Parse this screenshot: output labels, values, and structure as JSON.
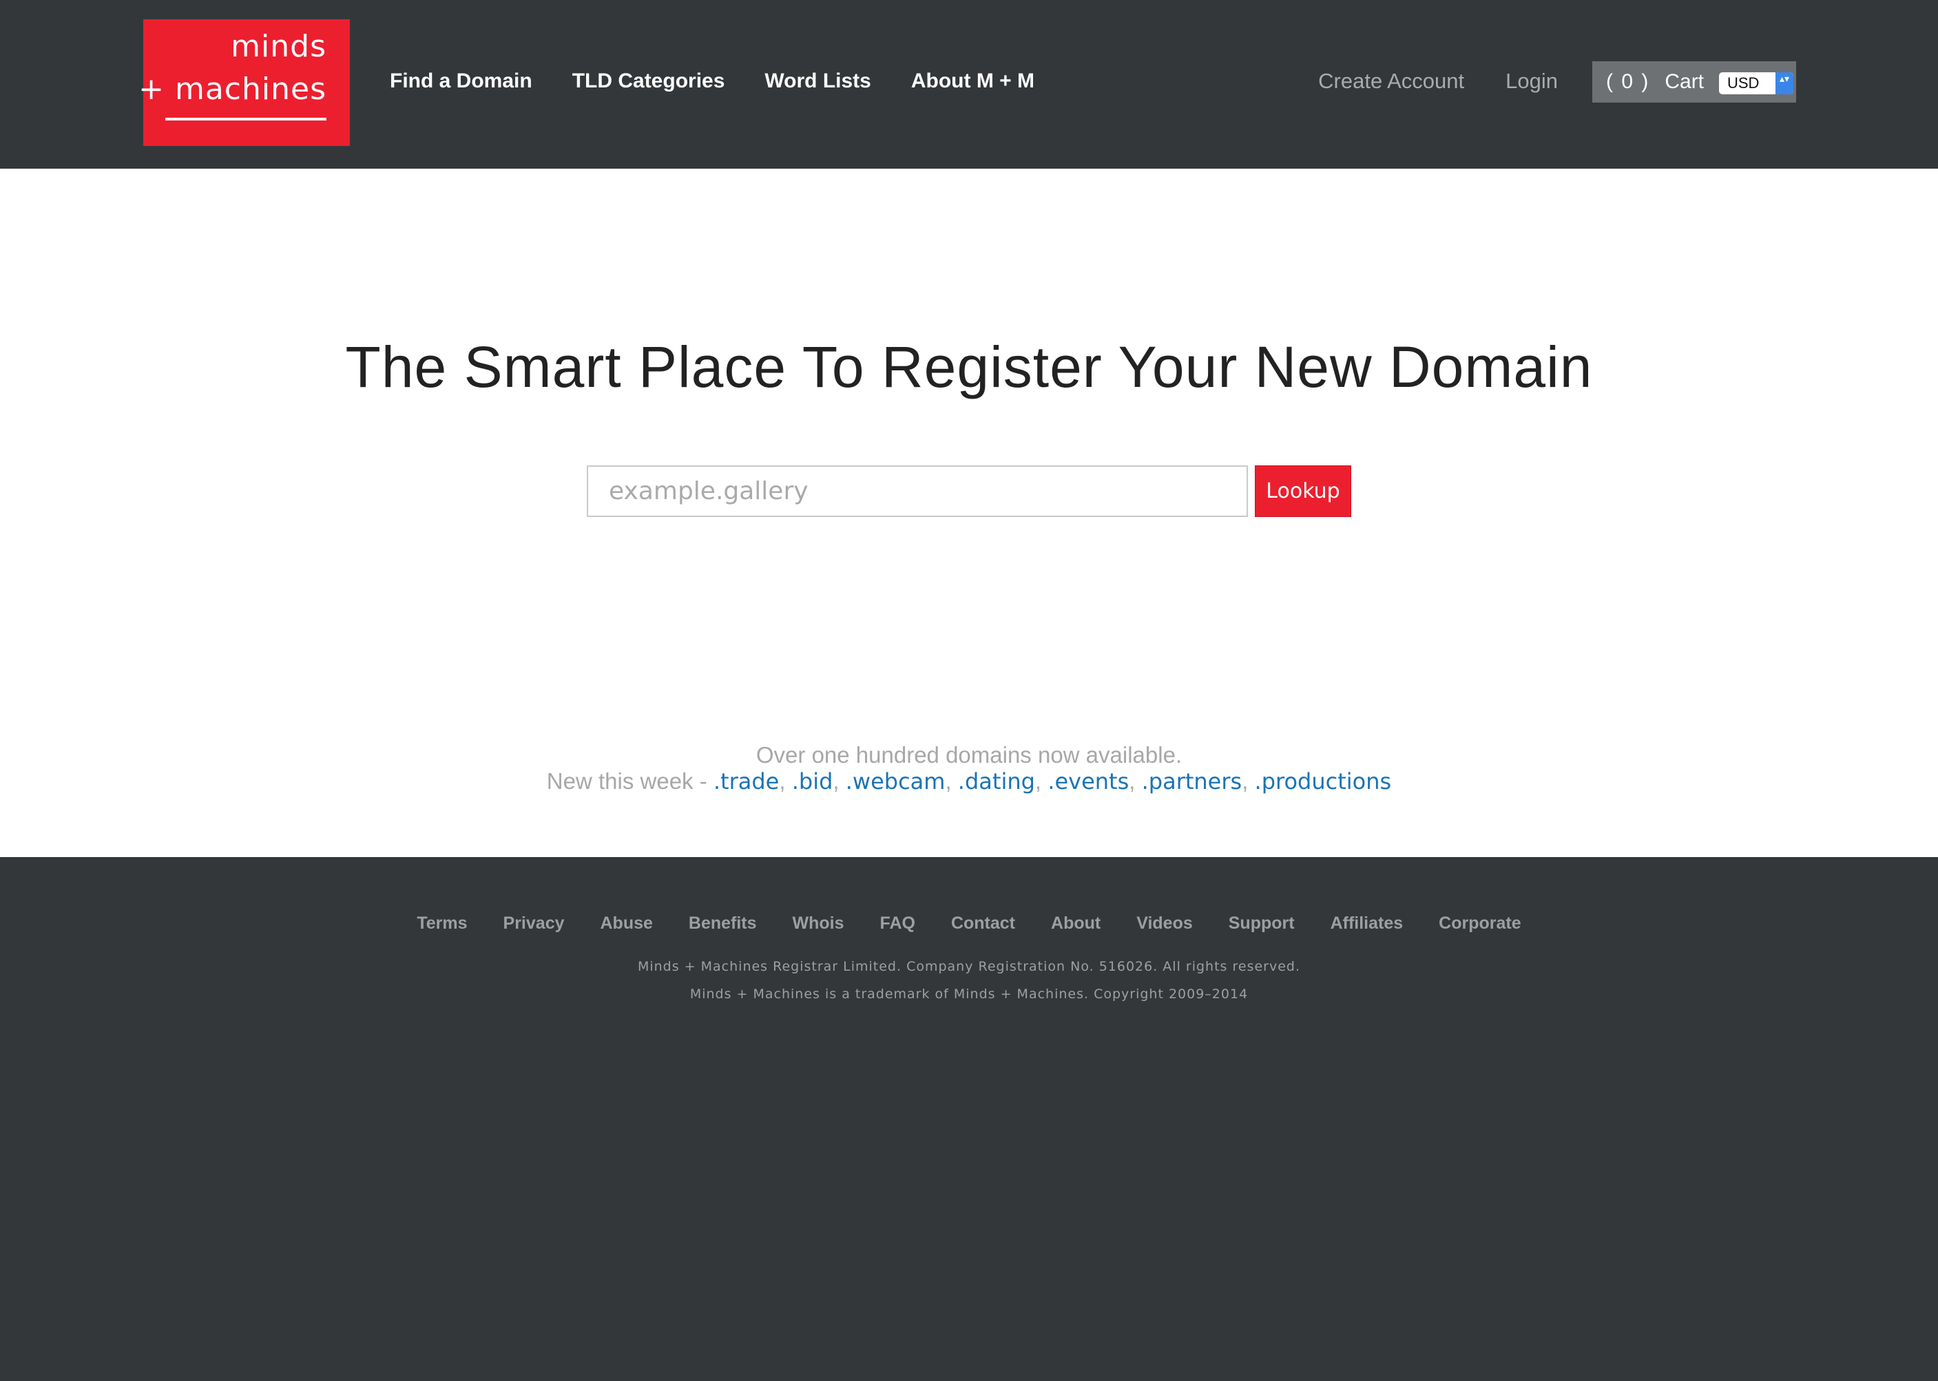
{
  "header": {
    "logo": {
      "line1": "minds",
      "line2": "+ machines"
    },
    "main_nav": [
      {
        "label": "Find a Domain"
      },
      {
        "label": "TLD Categories"
      },
      {
        "label": "Word Lists"
      },
      {
        "label": "About M + M"
      }
    ],
    "account_nav": {
      "create_account": "Create Account",
      "login": "Login"
    },
    "cart": {
      "count": "( 0 )",
      "label": "Cart",
      "currency": "USD",
      "currency_arrows": "▴▾"
    }
  },
  "hero": {
    "title": "The Smart Place To Register Your New Domain",
    "search": {
      "placeholder": "example.gallery",
      "value": "",
      "button_label": "Lookup"
    },
    "promo": {
      "line1": "Over one hundred domains now available.",
      "line2_prefix": "New this week - ",
      "new_tlds": [
        ".trade",
        ".bid",
        ".webcam",
        ".dating",
        ".events",
        ".partners",
        ".productions"
      ]
    }
  },
  "footer": {
    "links": [
      {
        "label": "Terms"
      },
      {
        "label": "Privacy"
      },
      {
        "label": "Abuse"
      },
      {
        "label": "Benefits"
      },
      {
        "label": "Whois"
      },
      {
        "label": "FAQ"
      },
      {
        "label": "Contact"
      },
      {
        "label": "About"
      },
      {
        "label": "Videos"
      },
      {
        "label": "Support"
      },
      {
        "label": "Affiliates"
      },
      {
        "label": "Corporate"
      }
    ],
    "legal_line1": "Minds + Machines Registrar Limited. Company Registration No. 516026. All rights reserved.",
    "legal_line2": "Minds + Machines is a trademark of Minds + Machines. Copyright 2009–2014"
  },
  "colors": {
    "brand_red": "#ec1f2f",
    "dark_background": "#343739",
    "link_blue": "#1a74b4",
    "muted_text": "#a7a7a7"
  }
}
